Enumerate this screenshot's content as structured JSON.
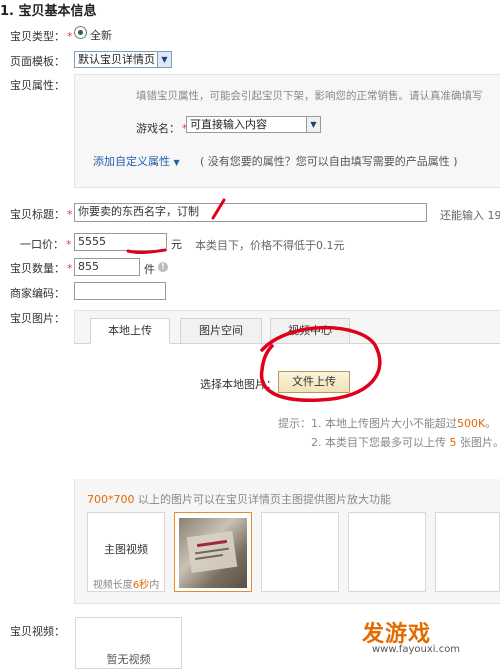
{
  "section": {
    "title": "1. 宝贝基本信息"
  },
  "type_row": {
    "label": "宝贝类型",
    "option": "全新"
  },
  "template_row": {
    "label": "页面模板",
    "value": "默认宝贝详情页"
  },
  "attributes": {
    "label": "宝贝属性",
    "notice": "填错宝贝属性，可能会引起宝贝下架，影响您的正常销售。请认真准确填写",
    "game_name_label": "游戏名",
    "game_name_value": "可直接输入内容",
    "add_custom": "添加自定义属性",
    "add_custom_hint": "( 没有您要的属性？您可以自由填写需要的产品属性 )"
  },
  "title_row": {
    "label": "宝贝标题",
    "value": "你要卖的东西名字，订制",
    "counter": "还能输入 19"
  },
  "price_row": {
    "label": "一口价",
    "value": "5555",
    "unit": "元",
    "hint": "本类目下，价格不得低于0.1元"
  },
  "quantity_row": {
    "label": "宝贝数量",
    "value": "855",
    "unit": "件"
  },
  "merchant_code_row": {
    "label": "商家编码",
    "value": ""
  },
  "images": {
    "label": "宝贝图片",
    "tabs": [
      "本地上传",
      "图片空间",
      "视频中心"
    ],
    "choose_label": "选择本地图片：",
    "upload_button": "文件上传",
    "tip_prefix": "提示：",
    "tip1_a": "1.  本地上传图片大小不能超过",
    "tip1_b": "500K",
    "tip1_c": "。",
    "tip2_a": "2.  本类目下您最多可以上传 ",
    "tip2_b": "5",
    "tip2_c": " 张图片。",
    "zoom_a": "700*700",
    "zoom_b": " 以上的图片可以在宝贝详情页主图提供图片放大功能",
    "video_slot_title": "主图视频",
    "video_slot_hint_a": "视频长度",
    "video_slot_hint_b": "6秒",
    "video_slot_hint_c": "内"
  },
  "video_row": {
    "label": "宝贝视频",
    "placeholder": "暂无视频"
  },
  "watermark": {
    "brand": "发游戏",
    "url": "www.fayouxi.com"
  },
  "colors": {
    "required": "#e4393c",
    "link": "#1f5fb0",
    "accent": "#e36b00",
    "annotation": "#e0001b"
  }
}
